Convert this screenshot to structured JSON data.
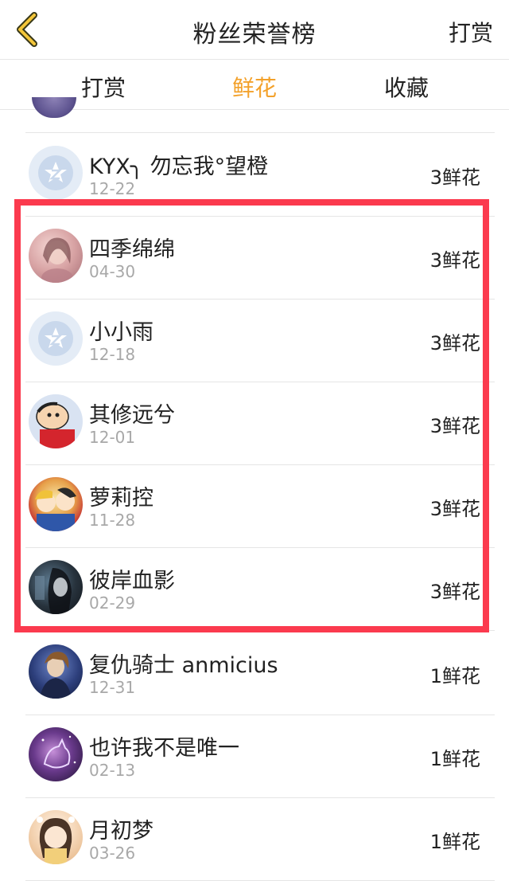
{
  "header": {
    "title": "粉丝荣誉榜",
    "right_action": "打赏",
    "back_icon": "chevron-left-icon"
  },
  "tabs": [
    {
      "label": "打赏",
      "active": false
    },
    {
      "label": "鲜花",
      "active": true
    },
    {
      "label": "收藏",
      "active": false
    }
  ],
  "colors": {
    "accent": "#f3a12a",
    "highlight": "#fb3a4e",
    "date_text": "#a8a8a8"
  },
  "rows": [
    {
      "name": "KYX╮ 勿忘我°望橙",
      "date": "12-22",
      "amount": "3鲜花",
      "avatar": "qq-default-avatar"
    },
    {
      "name": "四季绵绵",
      "date": "04-30",
      "amount": "3鲜花",
      "avatar": "girl-photo-avatar"
    },
    {
      "name": "小小雨",
      "date": "12-18",
      "amount": "3鲜花",
      "avatar": "qq-default-avatar"
    },
    {
      "name": "其修远兮",
      "date": "12-01",
      "amount": "3鲜花",
      "avatar": "crayon-shinchan-avatar"
    },
    {
      "name": "萝莉控",
      "date": "11-28",
      "amount": "3鲜花",
      "avatar": "anime-girls-avatar"
    },
    {
      "name": "彼岸血影",
      "date": "02-29",
      "amount": "3鲜花",
      "avatar": "dark-anime-avatar"
    },
    {
      "name": "复仇骑士 anmicius",
      "date": "12-31",
      "amount": "1鲜花",
      "avatar": "knight-anime-avatar"
    },
    {
      "name": "也许我不是唯一",
      "date": "02-13",
      "amount": "1鲜花",
      "avatar": "galaxy-cat-avatar"
    },
    {
      "name": "月初梦",
      "date": "03-26",
      "amount": "1鲜花",
      "avatar": "chibi-girl-avatar"
    }
  ]
}
